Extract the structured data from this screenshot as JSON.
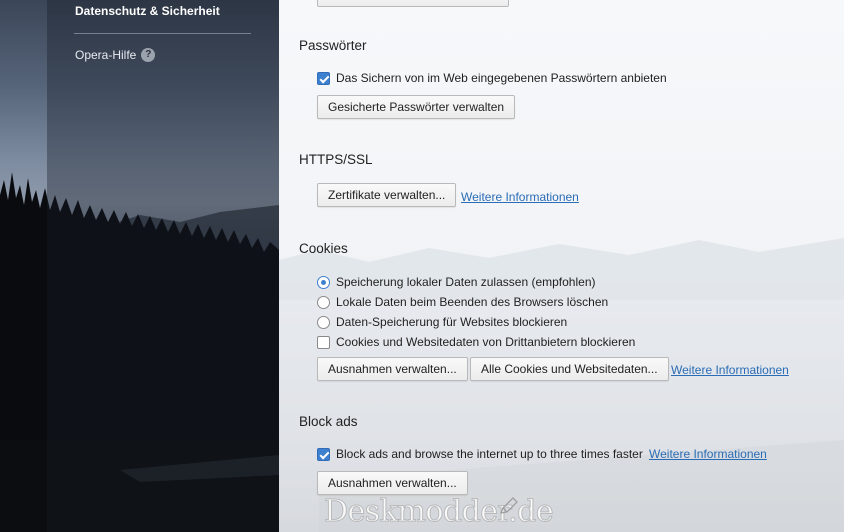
{
  "sidebar": {
    "active_item": "Datenschutz & Sicherheit",
    "help_item": "Opera-Hilfe",
    "help_icon": "?"
  },
  "passwords": {
    "title": "Passwörter",
    "offer_save_label": "Das Sichern von im Web eingegebenen Passwörtern anbieten",
    "offer_save_checked": true,
    "manage_button": "Gesicherte Passwörter verwalten"
  },
  "https": {
    "title": "HTTPS/SSL",
    "certs_button": "Zertifikate verwalten...",
    "more_info_link": "Weitere Informationen"
  },
  "cookies": {
    "title": "Cookies",
    "options": [
      {
        "label": "Speicherung lokaler Daten zulassen (empfohlen)",
        "selected": true
      },
      {
        "label": "Lokale Daten beim Beenden des Browsers löschen",
        "selected": false
      },
      {
        "label": "Daten-Speicherung für Websites blockieren",
        "selected": false
      }
    ],
    "third_party_label": "Cookies und Websitedaten von Drittanbietern blockieren",
    "third_party_checked": false,
    "exceptions_button": "Ausnahmen verwalten...",
    "all_cookies_button": "Alle Cookies und Websitedaten...",
    "more_info_link": "Weitere Informationen"
  },
  "block_ads": {
    "title": "Block ads",
    "enable_label": "Block ads and browse the internet up to three times faster",
    "enable_checked": true,
    "more_info_link": "Weitere Informationen",
    "exceptions_button": "Ausnahmen verwalten..."
  },
  "watermark": "Deskmodder.de",
  "colors": {
    "accent": "#3d80d0",
    "link": "#2a6cb5"
  }
}
